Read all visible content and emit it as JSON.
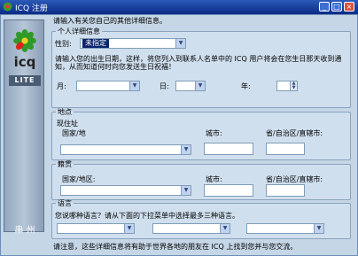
{
  "window": {
    "title": "ICQ 注册",
    "min_glyph": "_",
    "max_glyph": "□",
    "close_glyph": "×"
  },
  "sidebar": {
    "logo_text": "icq",
    "badge": "LITE",
    "brand": "串 州"
  },
  "intro": "请输入有关您自己的其他详细信息。",
  "personal": {
    "legend": "个人详细信息",
    "gender_label": "性别:",
    "gender_value": "未指定",
    "birthday_note": "请输入您的出生日期，这样，将您列入到联系人名单中的 ICQ 用户将会在您生日那天收到通知，从而知道何时向您发送生日祝福！",
    "month_label": "月:",
    "day_label": "日:",
    "year_label": "年:"
  },
  "location": {
    "legend": "地点",
    "current_label": "现住址",
    "country_label": "国家/地",
    "city_label": "城市:",
    "state_label": "省/自治区/直辖市:"
  },
  "origin": {
    "legend": "籍贯",
    "country_label": "国家/地区:",
    "city_label": "城市:",
    "state_label": "省/自治区/直辖市:"
  },
  "language": {
    "legend": "语言",
    "question": "您说哪种语言？请从下面的下拉菜单中选择最多三种语言。"
  },
  "footer": "请注意，这些详细信息将有助于世界各地的朋友在 ICQ 上找到您并与您交流。",
  "icons": {
    "dropdown": "▼",
    "spin_up": "▲",
    "spin_down": "▼"
  },
  "colors": {
    "titlebar": "#0a2b86",
    "background": "#c5d6e6",
    "selection": "#0a246a"
  }
}
